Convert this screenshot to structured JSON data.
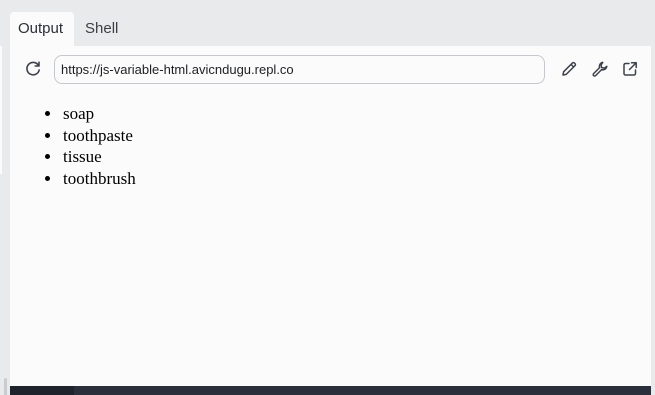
{
  "tabs": [
    {
      "label": "Output",
      "active": true
    },
    {
      "label": "Shell",
      "active": false
    }
  ],
  "toolbar": {
    "reload_icon": "reload-icon",
    "url": "https://js-variable-html.avicndugu.repl.co",
    "edit_icon": "pencil-icon",
    "devtools_icon": "wrench-icon",
    "open_external_icon": "external-link-icon"
  },
  "output": {
    "list_items": [
      "soap",
      "toothpaste",
      "tissue",
      "toothbrush"
    ]
  },
  "colors": {
    "chrome_background": "#e9eaec",
    "panel_background": "#fbfbfb",
    "icon_color": "#3c414a",
    "bottom_bar": "#2a2f3b"
  }
}
